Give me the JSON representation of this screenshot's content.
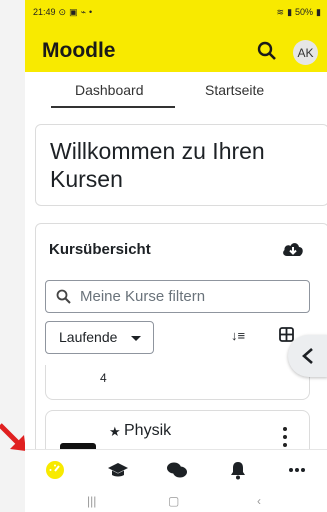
{
  "status": {
    "time": "21:49",
    "battery": "50%"
  },
  "app": {
    "title": "Moodle",
    "avatar_initials": "AK"
  },
  "tabs": [
    {
      "label": "Dashboard"
    },
    {
      "label": "Startseite"
    }
  ],
  "welcome": {
    "text": "Willkommen zu Ihren Kursen"
  },
  "overview": {
    "title": "Kursübersicht",
    "filter_placeholder": "Meine Kurse filtern",
    "dropdown_label": "Laufende",
    "partial_course_text": "4",
    "course": {
      "name": "Physik"
    }
  },
  "colors": {
    "accent": "#f8ea00",
    "nav_active": "#f8ea00"
  },
  "bottom_nav": [
    {
      "name": "dashboard-icon"
    },
    {
      "name": "courses-icon"
    },
    {
      "name": "messages-icon"
    },
    {
      "name": "notifications-icon"
    },
    {
      "name": "more-icon"
    }
  ]
}
